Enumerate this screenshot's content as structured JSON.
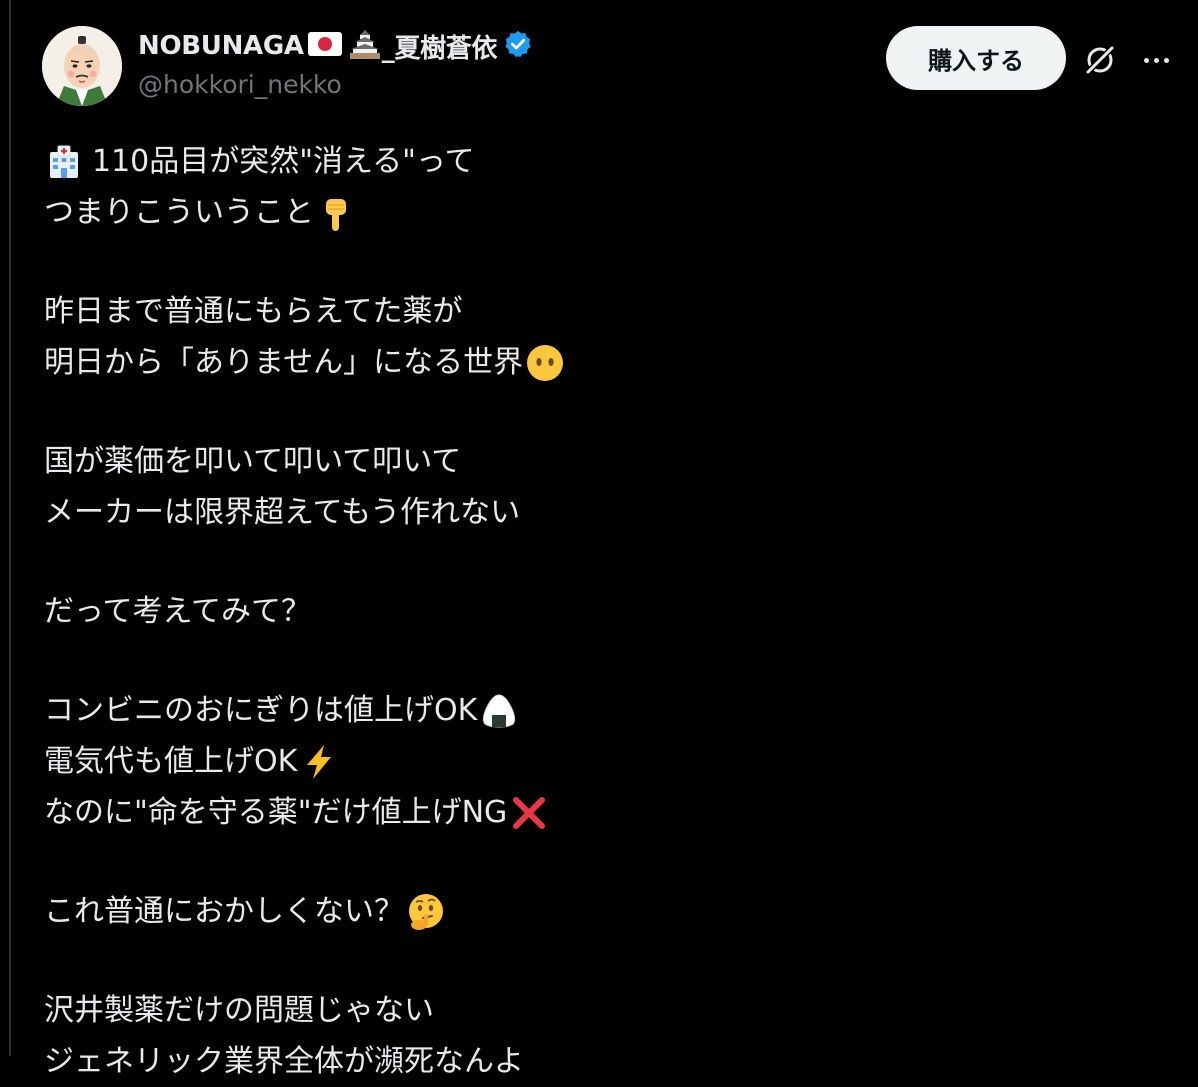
{
  "author": {
    "display_name": "NOBUNAGA",
    "name_suffix": "_夏樹蒼依",
    "handle": "@hokkori_nekko",
    "avatar_icon": "samurai-avatar-icon",
    "name_icons": [
      "japan-flag-icon",
      "castle-icon",
      "verified-badge-icon"
    ],
    "verified_color": "#1d9bf0"
  },
  "actions": {
    "buy_label": "購入する",
    "grok_icon": "grok-icon",
    "more_icon": "more-options-icon"
  },
  "tweet": {
    "lines": [
      {
        "text": "110品目が突然\"消える\"って",
        "emoji": "hospital-icon"
      },
      {
        "text": "つまりこういうこと",
        "emoji": "pointing-down-icon"
      },
      {
        "text": "昨日まで普通にもらえてた薬が"
      },
      {
        "text": "明日から「ありません」になる世界",
        "emoji": "face-without-mouth-icon"
      },
      {
        "text": "国が薬価を叩いて叩いて叩いて"
      },
      {
        "text": "メーカーは限界超えてもう作れない"
      },
      {
        "text": "だって考えてみて？"
      },
      {
        "text": "コンビニのおにぎりは値上げOK",
        "emoji": "rice-ball-icon"
      },
      {
        "text": "電気代も値上げOK",
        "emoji": "lightning-icon"
      },
      {
        "text": "なのに\"命を守る薬\"だけ値上げNG",
        "emoji": "cross-mark-icon"
      },
      {
        "text": "これ普通におかしくない？",
        "emoji": "thinking-face-icon"
      },
      {
        "text": "沢井製薬だけの問題じゃない"
      },
      {
        "text": "ジェネリック業界全体が瀕死なんよ"
      }
    ]
  },
  "colors": {
    "background": "#000000",
    "text_primary": "#e7e9ea",
    "text_secondary": "#71767b",
    "button_bg": "#eff3f4",
    "button_text": "#0f1419"
  }
}
